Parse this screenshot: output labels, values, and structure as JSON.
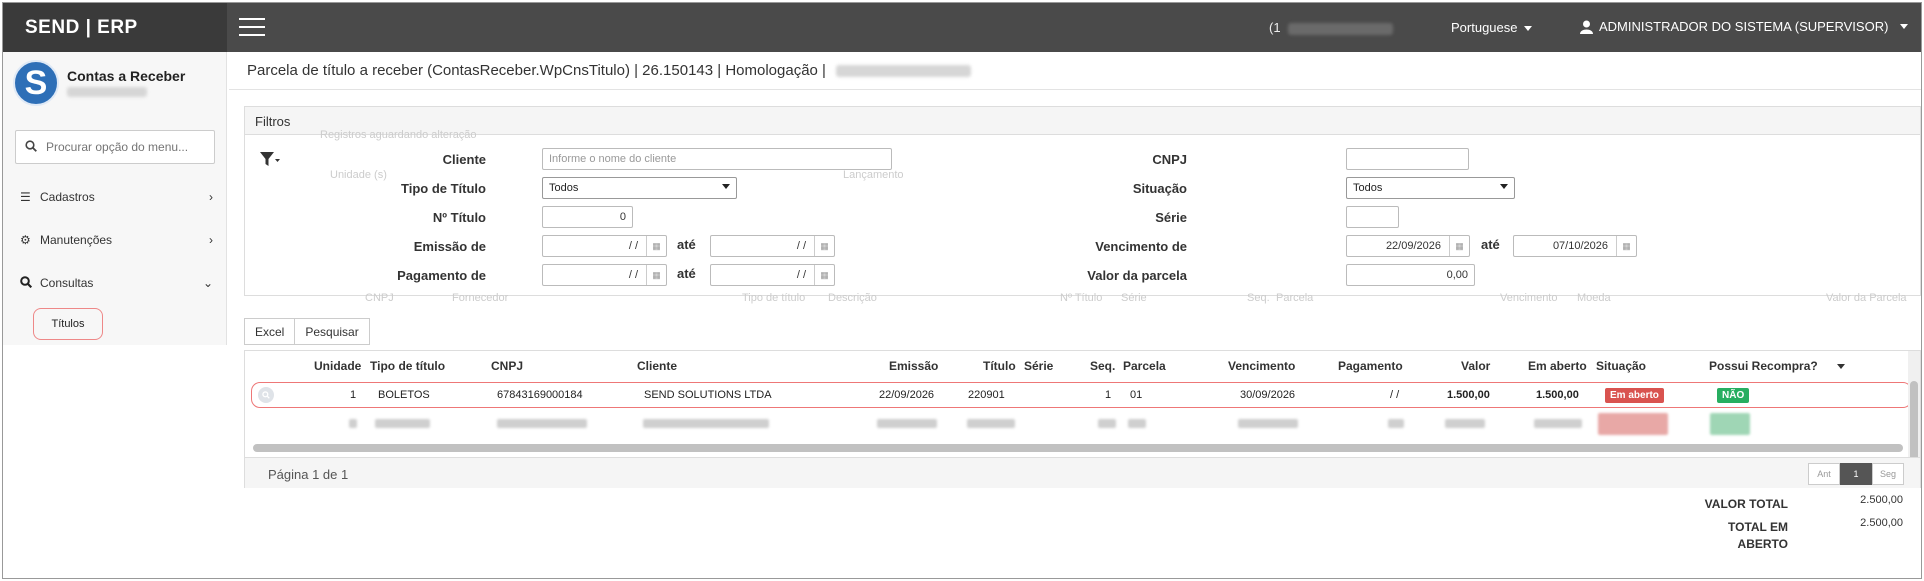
{
  "app": {
    "brand": "SEND | ERP"
  },
  "topbar": {
    "number_prefix": "(1",
    "language": "Portuguese",
    "user": "ADMINISTRADOR DO SISTEMA (SUPERVISOR)"
  },
  "sidebar": {
    "module_title": "Contas a Receber",
    "logo_letter": "S",
    "search_placeholder": "Procurar opção do menu...",
    "items": [
      {
        "label": "Cadastros",
        "icon": "list-icon"
      },
      {
        "label": "Manutenções",
        "icon": "cogs-icon"
      },
      {
        "label": "Consultas",
        "icon": "search-icon"
      }
    ],
    "sub_item": "Títulos"
  },
  "page": {
    "title": "Parcela de título a receber (ContasReceber.WpCnsTitulo) | 26.150143 | Homologação |"
  },
  "filters": {
    "heading": "Filtros",
    "cliente_label": "Cliente",
    "cliente_placeholder": "Informe o nome do cliente",
    "tipo_label": "Tipo de Título",
    "tipo_value": "Todos",
    "numero_label": "Nº Título",
    "numero_value": "0",
    "emissao_label": "Emissão de",
    "emissao_from": "/ /",
    "emissao_to": "/ /",
    "pagamento_label": "Pagamento de",
    "pagamento_from": "/ /",
    "pagamento_to": "/ /",
    "ate_label": "até",
    "cnpj_label": "CNPJ",
    "cnpj_value": "",
    "situacao_label": "Situação",
    "situacao_value": "Todos",
    "serie_label": "Série",
    "serie_value": "",
    "vencimento_label": "Vencimento de",
    "vencimento_from": "22/09/2026",
    "vencimento_to": "07/10/2026",
    "valor_label": "Valor da parcela",
    "valor_value": "0,00"
  },
  "ghost_text": {
    "unidade": "Unidade (s)",
    "lancamento": "Lançamento",
    "registro": "Registros aguardando alteração",
    "col_cnpj": "CNPJ",
    "col_fornecedor": "Fornecedor",
    "col_tipo": "Tipo de título",
    "col_descricao": "Descrição",
    "col_numero": "Nº Título",
    "col_serie": "Série",
    "col_seq": "Seq.",
    "col_parcela": "Parcela",
    "col_vencimento": "Vencimento",
    "col_moeda": "Moeda",
    "col_valor": "Valor da Parcela"
  },
  "toolbar": {
    "excel": "Excel",
    "pesquisar": "Pesquisar"
  },
  "grid": {
    "headers": {
      "unidade": "Unidade",
      "tipo": "Tipo de título",
      "cnpj": "CNPJ",
      "cliente": "Cliente",
      "emissao": "Emissão",
      "titulo": "Título",
      "serie": "Série",
      "seq": "Seq.",
      "parcela": "Parcela",
      "vencimento": "Vencimento",
      "pagamento": "Pagamento",
      "valor": "Valor",
      "em_aberto": "Em aberto",
      "situacao": "Situação",
      "recompra": "Possui Recompra?"
    },
    "row": {
      "unidade": "1",
      "tipo": "BOLETOS",
      "cnpj": "67843169000184",
      "cliente": "SEND SOLUTIONS LTDA",
      "emissao": "22/09/2026",
      "titulo": "220901",
      "serie": "",
      "seq": "1",
      "parcela": "01",
      "vencimento": "30/09/2026",
      "pagamento": "/ /",
      "valor": "1.500,00",
      "em_aberto": "1.500,00",
      "situacao": "Em aberto",
      "recompra": "NÃO"
    },
    "page_info": "Página 1 de 1",
    "pager": {
      "prev": "Ant",
      "current": "1",
      "next": "Seg"
    }
  },
  "totals": {
    "valor_total_label": "VALOR TOTAL",
    "valor_total": "2.500,00",
    "em_aberto_label": "TOTAL EM ABERTO",
    "em_aberto": "2.500,00"
  },
  "colors": {
    "topbar": "#4a4a4a",
    "brand_bg": "#3a3a3a",
    "logo": "#2e6fb7",
    "badge_open": "#d9534f",
    "badge_no": "#27ae60",
    "highlight": "#e77777"
  }
}
